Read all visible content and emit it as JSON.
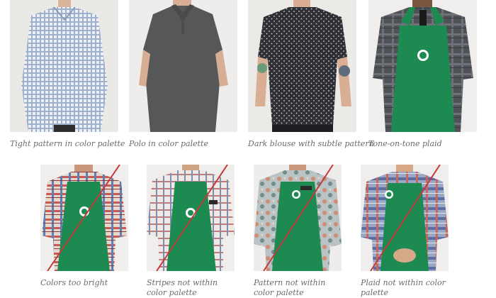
{
  "colors": {
    "apron_green": "#1d8a52",
    "strike_red": "#c43a3a",
    "caption_gray": "#6b6b6b"
  },
  "top_row": [
    {
      "caption": "Tight pattern in color palette"
    },
    {
      "caption": "Polo in color palette"
    },
    {
      "caption": "Dark blouse with subtle pattern"
    },
    {
      "caption": "Tone-on-tone plaid"
    }
  ],
  "bottom_row": [
    {
      "caption": "Colors too bright"
    },
    {
      "caption": "Stripes not within color palette"
    },
    {
      "caption": "Pattern not within color palette"
    },
    {
      "caption": "Plaid not within color palette"
    }
  ]
}
